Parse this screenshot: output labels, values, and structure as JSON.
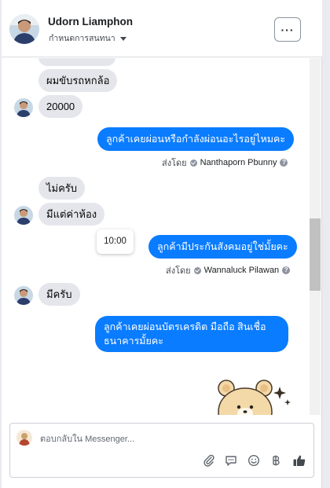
{
  "header": {
    "name": "Udorn Liamphon",
    "status": "กำหนดการสนทนา",
    "more_label": "···"
  },
  "messages": {
    "m1": "ผมขับรถหกล้อ",
    "m2": "20000",
    "m3": "ลูกค้าเคยผ่อนหรือกำลังผ่อนอะไรอยู่ไหมคะ",
    "m3_sentby_label": "ส่งโดย",
    "m3_sender": "Nanthaporn Pbunny",
    "m4": "ไม่ครับ",
    "m5": "มีแต่ค่าห้อง",
    "m6": "ลูกค้ามีประกันสังคมอยู่ใช่มั้ยคะ",
    "m6_sentby_label": "ส่งโดย",
    "m6_sender": "Wannaluck Pilawan",
    "m7": "มีครับ",
    "m8_line1": "ลูกค้าเคยผ่อนบัตรเครดิต มือถือ สินเชื่อ",
    "m8_line2": "ธนาคารมั้ยคะ"
  },
  "tooltip": {
    "time": "10:00"
  },
  "composer": {
    "placeholder": "ตอบกลับใน Messenger...",
    "tools": [
      "attachment-icon",
      "saved-reply-icon",
      "emoji-icon",
      "baht-payment-icon",
      "thumbs-up-icon"
    ]
  },
  "colors": {
    "outgoing": "#0a7cff",
    "incoming": "#e4e6eb",
    "accent": "#1c1e21"
  }
}
